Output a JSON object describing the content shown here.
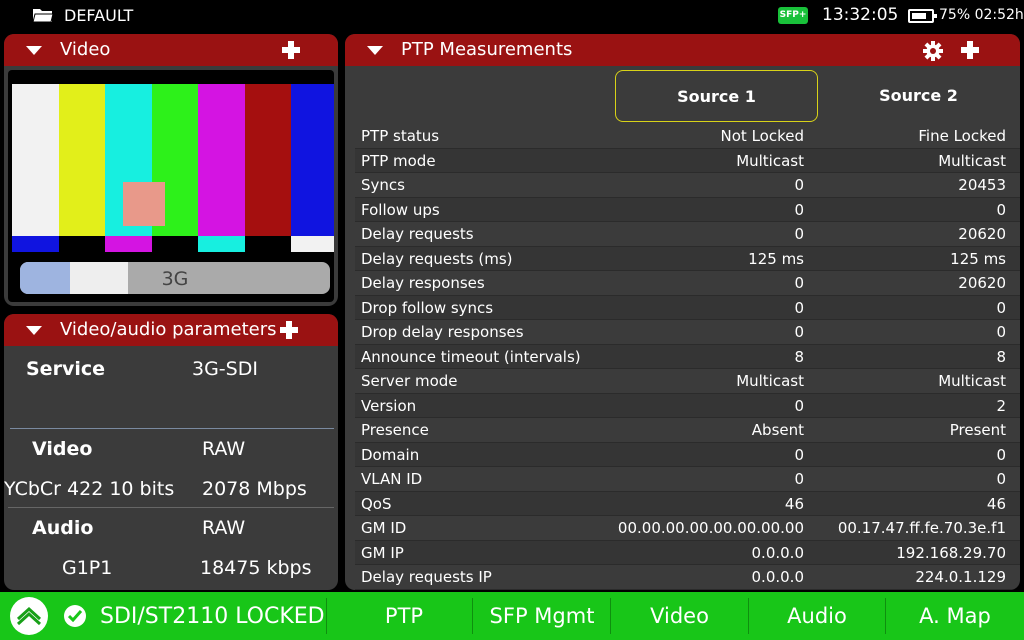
{
  "topbar": {
    "preset": "DEFAULT",
    "sfp_badge": "SFP+",
    "time": "13:32:05",
    "battery": "75% 02:52h"
  },
  "video_panel": {
    "title": "Video",
    "format": "3G",
    "bar_colors": [
      "#f2f2f2",
      "#e2ef1a",
      "#17efe0",
      "#2df11a",
      "#d414e2",
      "#a50f0f",
      "#1014e0"
    ],
    "sub_bar_colors": [
      "#1014e0",
      "#000000",
      "#d414e2",
      "#000000",
      "#17efe0",
      "#000000",
      "#f2f2f2"
    ]
  },
  "params_panel": {
    "title": "Video/audio parameters",
    "service_label": "Service",
    "service_value": "3G-SDI",
    "video_label": "Video",
    "video_value": "RAW",
    "video_format": "YCbCr 422 10 bits",
    "video_rate": "2078 Mbps",
    "audio_label": "Audio",
    "audio_value": "RAW",
    "audio_group": "G1P1",
    "audio_rate": "18475 kbps"
  },
  "ptp_panel": {
    "title": "PTP Measurements",
    "source1": "Source 1",
    "source2": "Source 2",
    "rows": [
      {
        "label": "PTP status",
        "s1": "Not Locked",
        "s2": "Fine Locked"
      },
      {
        "label": "PTP mode",
        "s1": "Multicast",
        "s2": "Multicast"
      },
      {
        "label": "Syncs",
        "s1": "0",
        "s2": "20453"
      },
      {
        "label": "Follow ups",
        "s1": "0",
        "s2": "0"
      },
      {
        "label": "Delay requests",
        "s1": "0",
        "s2": "20620"
      },
      {
        "label": "Delay requests (ms)",
        "s1": "125 ms",
        "s2": "125 ms"
      },
      {
        "label": "Delay responses",
        "s1": "0",
        "s2": "20620"
      },
      {
        "label": "Drop follow syncs",
        "s1": "0",
        "s2": "0"
      },
      {
        "label": "Drop delay responses",
        "s1": "0",
        "s2": "0"
      },
      {
        "label": "Announce timeout (intervals)",
        "s1": "8",
        "s2": "8"
      },
      {
        "label": "Server mode",
        "s1": "Multicast",
        "s2": "Multicast"
      },
      {
        "label": "Version",
        "s1": "0",
        "s2": "2"
      },
      {
        "label": "Presence",
        "s1": "Absent",
        "s2": "Present"
      },
      {
        "label": "Domain",
        "s1": "0",
        "s2": "0"
      },
      {
        "label": "VLAN ID",
        "s1": "0",
        "s2": "0"
      },
      {
        "label": "QoS",
        "s1": "46",
        "s2": "46"
      },
      {
        "label": "GM ID",
        "s1": "00.00.00.00.00.00.00.00",
        "s2": "00.17.47.ff.fe.70.3e.f1"
      },
      {
        "label": "GM IP",
        "s1": "0.0.0.0",
        "s2": "192.168.29.70"
      },
      {
        "label": "Delay requests IP",
        "s1": "0.0.0.0",
        "s2": "224.0.1.129"
      }
    ]
  },
  "bottombar": {
    "status": "SDI/ST2110 LOCKED",
    "tabs": [
      "PTP",
      "SFP Mgmt",
      "Video",
      "Audio",
      "A. Map"
    ],
    "accent_color": "#18c618"
  }
}
